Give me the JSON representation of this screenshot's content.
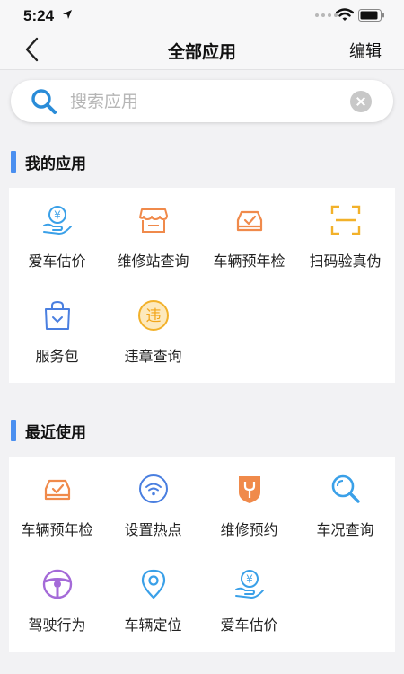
{
  "status": {
    "time": "5:24"
  },
  "nav": {
    "title": "全部应用",
    "edit_label": "编辑"
  },
  "search": {
    "placeholder": "搜索应用",
    "value": ""
  },
  "sections": [
    {
      "title": "我的应用",
      "apps": [
        "爱车估价",
        "维修站查询",
        "车辆预年检",
        "扫码验真伪",
        "服务包",
        "违章查询"
      ]
    },
    {
      "title": "最近使用",
      "apps": [
        "车辆预年检",
        "设置热点",
        "维修预约",
        "车况查询",
        "驾驶行为",
        "车辆定位",
        "爱车估价"
      ]
    }
  ],
  "colors": {
    "accent": "#4a8ff0",
    "orange": "#f08a4b",
    "blue": "#3aa0e8",
    "purple": "#a46ad8",
    "gold": "#f2b12a"
  }
}
